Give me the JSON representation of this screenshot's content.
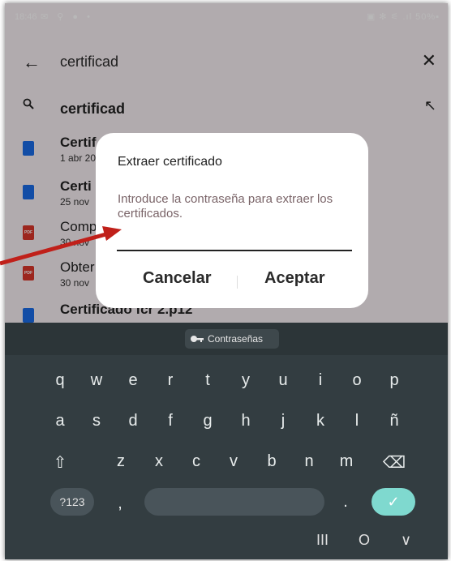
{
  "status": {
    "time": "18:46",
    "left_icons": "✉ ⚲ ●  •",
    "right_icons": "▣ ✻ ⚟ .ıl 50%▪"
  },
  "search": {
    "query": "certificad"
  },
  "suggestion": {
    "text": "certificad"
  },
  "files": [
    {
      "name": "Certif",
      "meta": "1 abr 20",
      "type": "doc",
      "bold": true
    },
    {
      "name": "Certi",
      "meta": "25 nov",
      "type": "doc",
      "bold": true
    },
    {
      "name": "Comp",
      "meta": "30 nov",
      "type": "pdf",
      "bold": false
    },
    {
      "name": "Obter",
      "meta": "30 nov",
      "type": "pdf",
      "bold": false
    },
    {
      "name": "Certificado fcr 2.p12",
      "meta": "",
      "type": "doc",
      "bold": true
    }
  ],
  "pdf_label": "PDF",
  "dialog": {
    "title": "Extraer certificado",
    "message": "Introduce la contraseña para extraer los certificados.",
    "cancel": "Cancelar",
    "accept": "Aceptar"
  },
  "keyboard": {
    "passwords_label": "Contraseñas",
    "row1": [
      "q",
      "w",
      "e",
      "r",
      "t",
      "y",
      "u",
      "i",
      "o",
      "p"
    ],
    "row2": [
      "a",
      "s",
      "d",
      "f",
      "g",
      "h",
      "j",
      "k",
      "l",
      "ñ"
    ],
    "row3": [
      "⇧",
      "z",
      "x",
      "c",
      "v",
      "b",
      "n",
      "m",
      "⌫"
    ],
    "mode_label": "?123",
    "comma": ",",
    "period": ".",
    "enter": "✓",
    "nav": [
      "III",
      "O",
      "∨"
    ]
  },
  "colors": {
    "accent_enter": "#7fd9cf",
    "annotation_arrow": "#c0201a",
    "doc_icon": "#1a6be6",
    "pdf_icon": "#d8352a"
  }
}
